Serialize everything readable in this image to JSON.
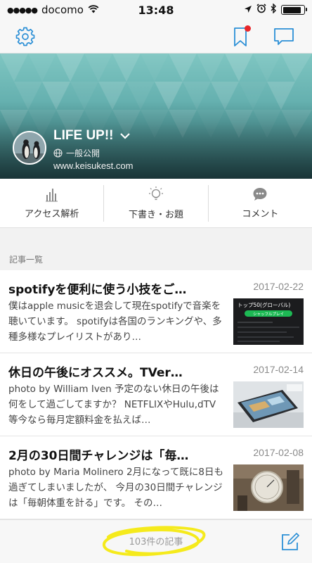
{
  "status_bar": {
    "carrier": "docomo",
    "signal_dots": "●●●●●",
    "time": "13:48"
  },
  "nav": {
    "icons": [
      "gear-icon",
      "bookmark-icon",
      "chat-bubble-icon"
    ],
    "accent_color": "#2b8fd6",
    "notification_color": "#e8262a"
  },
  "blog": {
    "title": "LIFE UP!!",
    "visibility": "一般公開",
    "url": "www.keisukest.com"
  },
  "actions": [
    {
      "label": "アクセス解析",
      "icon": "bar-chart-icon"
    },
    {
      "label": "下書き・お題",
      "icon": "lightbulb-icon"
    },
    {
      "label": "コメント",
      "icon": "comment-icon"
    }
  ],
  "section": {
    "label": "記事一覧"
  },
  "articles": [
    {
      "title": "spotifyを便利に使う小技をご…",
      "date": "2017-02-22",
      "excerpt": "僕はapple musicを退会して現在spotifyで音楽を聴いています。 spotifyは各国のランキングや、多種多様なプレイリストがあり…",
      "thumb_title": "トップ50(グローバル)",
      "thumb_button": "シャッフルプレイ"
    },
    {
      "title": "休日の午後にオススメ。TVer…",
      "date": "2017-02-14",
      "excerpt": "photo by William Iven 予定のない休日の午後は何をして過ごしてますか？ NETFLIXやHulu,dTV等今なら毎月定額料金を払えば…"
    },
    {
      "title": "2月の30日間チャレンジは「毎…",
      "date": "2017-02-08",
      "excerpt": "photo by Maria Molinero 2月になって既に8日も過ぎてしまいましたが、 今月の30日間チャレンジは「毎朝体重を計る」です。 その…"
    }
  ],
  "footer": {
    "count": "103件の記事",
    "highlight_color": "#f5ea1c"
  }
}
